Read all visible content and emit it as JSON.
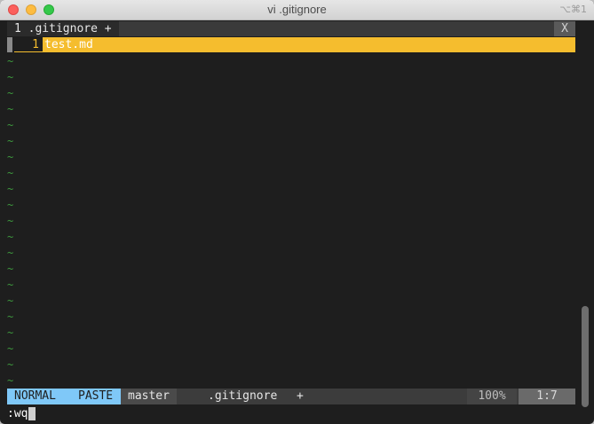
{
  "window": {
    "title": "vi .gitignore",
    "shortcut": "⌥⌘1"
  },
  "tabline": {
    "tab_label": "1 .gitignore +",
    "close_label": "X"
  },
  "buffer": {
    "lines": [
      {
        "number": "1",
        "text": "test.md"
      }
    ],
    "empty_marker": "~"
  },
  "statusline": {
    "mode": "NORMAL",
    "paste": "PASTE",
    "branch": "master",
    "filename": ".gitignore",
    "modified": "+",
    "percent": "100%",
    "position": "1:7"
  },
  "cmdline": {
    "text": ":wq"
  },
  "colors": {
    "accent": "#f5bd2e",
    "mode_bg": "#7fc8f8",
    "tilde": "#3e9a3e",
    "background": "#1e1e1e"
  }
}
